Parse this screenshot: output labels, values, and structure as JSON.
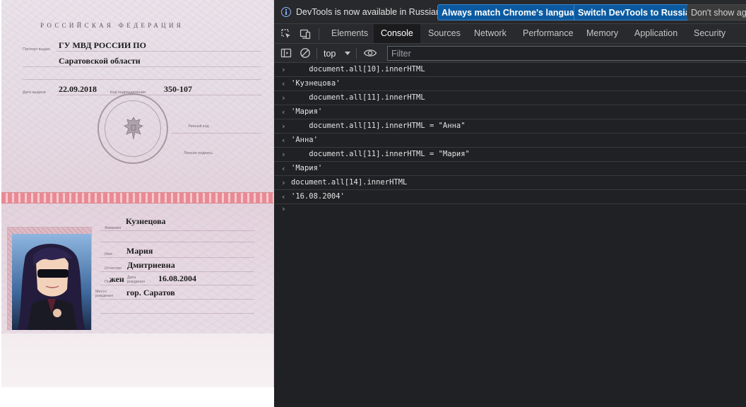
{
  "passport": {
    "country_title": "РОССИЙСКАЯ ФЕДЕРАЦИЯ",
    "issued_by_label": "Паспорт выдан",
    "issued_by_line1": "ГУ МВД РОССИИ ПО",
    "issued_by_line2": "Саратовской области",
    "issue_date_label": "Дата выдачи",
    "issue_date": "22.09.2018",
    "division_code_label": "Код подразделения",
    "division_code": "350-107",
    "personal_code_label": "Личный код",
    "signature_label": "Личная подпись",
    "surname_label": "Фамилия",
    "surname": "Кузнецова",
    "name_label": "Имя",
    "name": "Мария",
    "patronymic_label": "Отчество",
    "patronymic": "Дмитриевна",
    "sex_label": "Пол",
    "sex": "жен",
    "birth_date_label": "Дата рождения",
    "birth_date": "16.08.2004",
    "birth_place_label": "Место рождения",
    "birth_place": "гор. Саратов"
  },
  "devtools": {
    "infobar": {
      "message": "DevTools is now available in Russian!",
      "match_button": "Always match Chrome's language",
      "switch_button": "Switch DevTools to Russian",
      "dont_show_button": "Don't show ag"
    },
    "tabs": [
      {
        "label": "Elements"
      },
      {
        "label": "Console"
      },
      {
        "label": "Sources"
      },
      {
        "label": "Network"
      },
      {
        "label": "Performance"
      },
      {
        "label": "Memory"
      },
      {
        "label": "Application"
      },
      {
        "label": "Security"
      }
    ],
    "active_tab": "Console",
    "toolbar": {
      "context": "top",
      "filter_placeholder": "Filter"
    },
    "console": {
      "entries": [
        {
          "kind": "input",
          "text": "    document.all[10].innerHTML"
        },
        {
          "kind": "output",
          "text": "'Кузнецова'"
        },
        {
          "kind": "input",
          "text": "    document.all[11].innerHTML"
        },
        {
          "kind": "output",
          "text": "'Мария'"
        },
        {
          "kind": "input",
          "text": "    document.all[11].innerHTML = \"Анна\""
        },
        {
          "kind": "output",
          "text": "'Анна'"
        },
        {
          "kind": "input",
          "text": "    document.all[11].innerHTML = \"Мария\""
        },
        {
          "kind": "output",
          "text": "'Мария'"
        },
        {
          "kind": "input",
          "text": "document.all[14].innerHTML"
        },
        {
          "kind": "output",
          "text": "'16.08.2004'"
        }
      ]
    },
    "colors": {
      "accent": "#0b5aa0",
      "output_string": "#5cd5c8",
      "input_string": "#f28b82",
      "background": "#202124"
    }
  }
}
